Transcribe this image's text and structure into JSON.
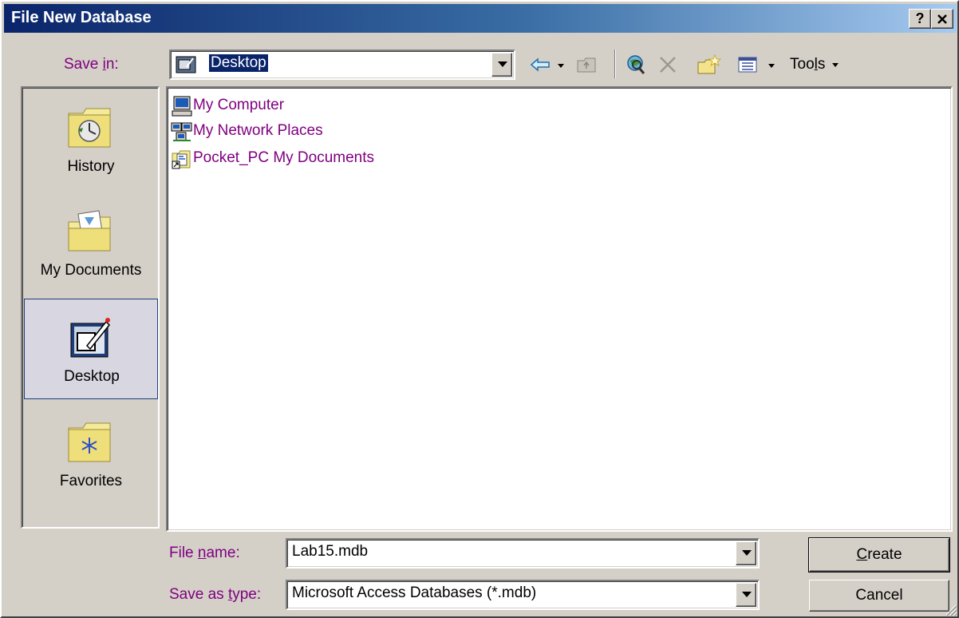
{
  "window": {
    "title": "File New Database",
    "help_glyph": "?",
    "close_glyph": "✕"
  },
  "save_in": {
    "label_pre": "Save ",
    "label_key": "i",
    "label_post": "n:",
    "value": "Desktop"
  },
  "toolbar": {
    "tools_pre": "Too",
    "tools_key": "l",
    "tools_post": "s"
  },
  "places": [
    {
      "label": "History",
      "icon": "history-folder-icon"
    },
    {
      "label": "My Documents",
      "icon": "my-documents-folder-icon"
    },
    {
      "label": "Desktop",
      "icon": "desktop-icon",
      "selected": true
    },
    {
      "label": "Favorites",
      "icon": "favorites-folder-icon"
    }
  ],
  "files": [
    {
      "name": "My Computer",
      "icon": "my-computer-icon"
    },
    {
      "name": "My Network Places",
      "icon": "network-places-icon"
    },
    {
      "name": "Pocket_PC My Documents",
      "icon": "pocketpc-shortcut-icon"
    }
  ],
  "file_name": {
    "label_pre": "File ",
    "label_key": "n",
    "label_post": "ame:",
    "value": "Lab15.mdb"
  },
  "save_as_type": {
    "label_pre": "Save as ",
    "label_key": "t",
    "label_post": "ype:",
    "value": "Microsoft Access Databases (*.mdb)"
  },
  "buttons": {
    "create_key": "C",
    "create_rest": "reate",
    "cancel": "Cancel"
  },
  "colors": {
    "title_start": "#0a246a",
    "title_end": "#a6caf0",
    "link": "#800080",
    "face": "#d4d0c8"
  }
}
